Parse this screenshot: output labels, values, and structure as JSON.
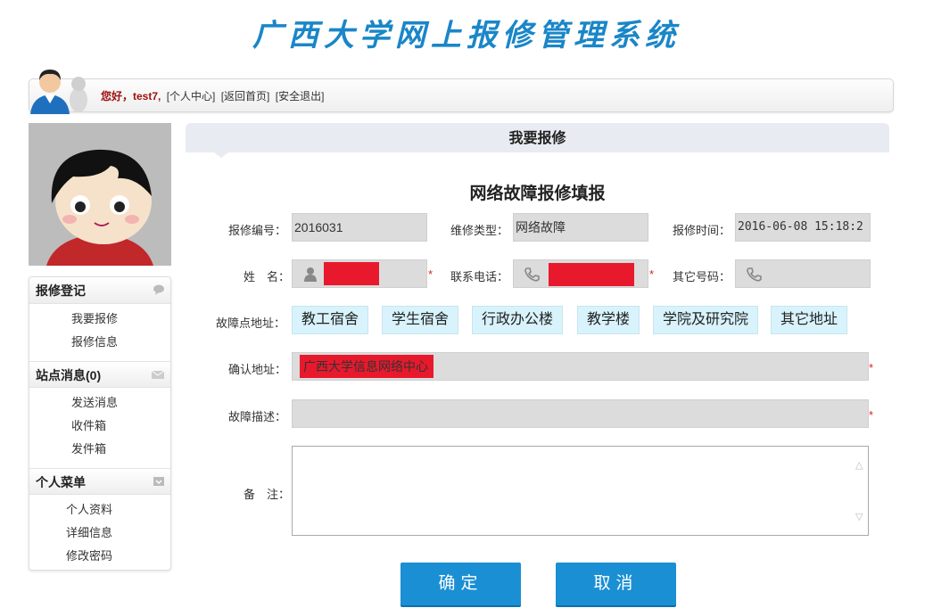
{
  "site": {
    "title": "广西大学网上报修管理系统"
  },
  "userbar": {
    "greeting": "您好，test7,",
    "links": [
      "[个人中心]",
      "[返回首页]",
      "[安全退出]"
    ]
  },
  "sidebar": {
    "sections": [
      {
        "title": "报修登记",
        "icon": "comment-icon",
        "items": [
          "我要报修",
          "报修信息"
        ]
      },
      {
        "title": "站点消息(0)",
        "icon": "mail-icon",
        "items": [
          "发送消息",
          "收件箱",
          "发件箱"
        ]
      },
      {
        "title": "个人菜单",
        "icon": "inbox-icon",
        "items": [
          "个人资料",
          "详细信息",
          "修改密码"
        ]
      }
    ]
  },
  "panel": {
    "title": "我要报修"
  },
  "form": {
    "title": "网络故障报修填报",
    "repair_no": {
      "label": "报修编号：",
      "value": "2016031"
    },
    "repair_type": {
      "label": "维修类型：",
      "value": "网络故障"
    },
    "repair_time": {
      "label": "报修时间：",
      "value": "2016-06-08 15:18:2"
    },
    "name": {
      "label": "姓　名：",
      "value": "",
      "icon": "user-icon"
    },
    "phone": {
      "label": "联系电话：",
      "value": "",
      "icon": "phone-icon"
    },
    "other_phone": {
      "label": "其它号码：",
      "value": "",
      "icon": "phone-icon"
    },
    "location": {
      "label": "故障点地址：",
      "options": [
        "教工宿舍",
        "学生宿舍",
        "行政办公楼",
        "教学楼",
        "学院及研究院",
        "其它地址"
      ]
    },
    "confirm_address": {
      "label": "确认地址：",
      "value": "广西大学信息网络中心"
    },
    "description": {
      "label": "故障描述：",
      "value": ""
    },
    "remark": {
      "label": "备　注：",
      "value": ""
    },
    "required_mark": "*"
  },
  "buttons": {
    "confirm": "确定",
    "cancel": "取消"
  },
  "colors": {
    "title_blue": "#1a86c8",
    "button_blue": "#1b8fd3",
    "chip_bg": "#d8f3fb",
    "redaction": "#e8192c"
  }
}
